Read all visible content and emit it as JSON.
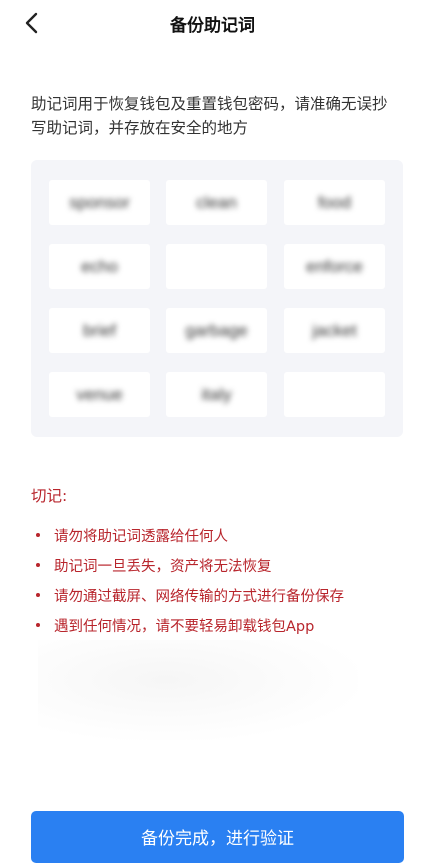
{
  "nav": {
    "title": "备份助记词"
  },
  "intro": "助记词用于恢复钱包及重置钱包密码，请准确无误抄写助记词，并存放在安全的地方",
  "words": [
    "sponsor",
    "clean",
    "food",
    "echo",
    "",
    "enforce",
    "brief",
    "garbage",
    "jacket",
    "venue",
    "italy",
    ""
  ],
  "warning": {
    "title": "切记:",
    "items": [
      "请勿将助记词透露给任何人",
      "助记词一旦丢失，资产将无法恢复",
      "请勿通过截屏、网络传输的方式进行备份保存",
      "遇到任何情况，请不要轻易卸载钱包App"
    ]
  },
  "confirm_button": "备份完成，进行验证",
  "colors": {
    "accent": "#2a80f2",
    "warning": "#b8252c",
    "grid_bg": "#f4f5f9"
  }
}
